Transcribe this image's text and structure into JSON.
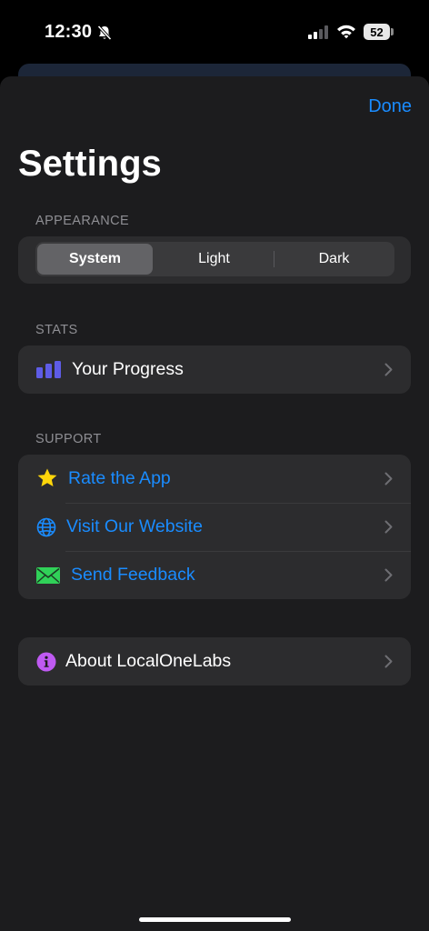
{
  "status": {
    "time": "12:30",
    "battery": "52"
  },
  "header": {
    "done_label": "Done",
    "title": "Settings"
  },
  "appearance": {
    "header": "APPEARANCE",
    "options": [
      "System",
      "Light",
      "Dark"
    ],
    "selected": "System"
  },
  "stats": {
    "header": "STATS",
    "items": [
      {
        "label": "Your Progress",
        "icon": "bar-chart-icon"
      }
    ]
  },
  "support": {
    "header": "SUPPORT",
    "items": [
      {
        "label": "Rate the App",
        "icon": "star-icon"
      },
      {
        "label": "Visit Our Website",
        "icon": "globe-icon"
      },
      {
        "label": "Send Feedback",
        "icon": "envelope-icon"
      }
    ]
  },
  "about": {
    "items": [
      {
        "label": "About LocalOneLabs",
        "icon": "info-icon"
      }
    ]
  },
  "colors": {
    "accent": "#1a8cff",
    "sheet_bg": "#1c1c1e",
    "group_bg": "#2c2c2e",
    "progress_icon": "#5e5ce6",
    "star": "#ffd60a",
    "envelope": "#30d158",
    "info": "#bf5af2"
  }
}
